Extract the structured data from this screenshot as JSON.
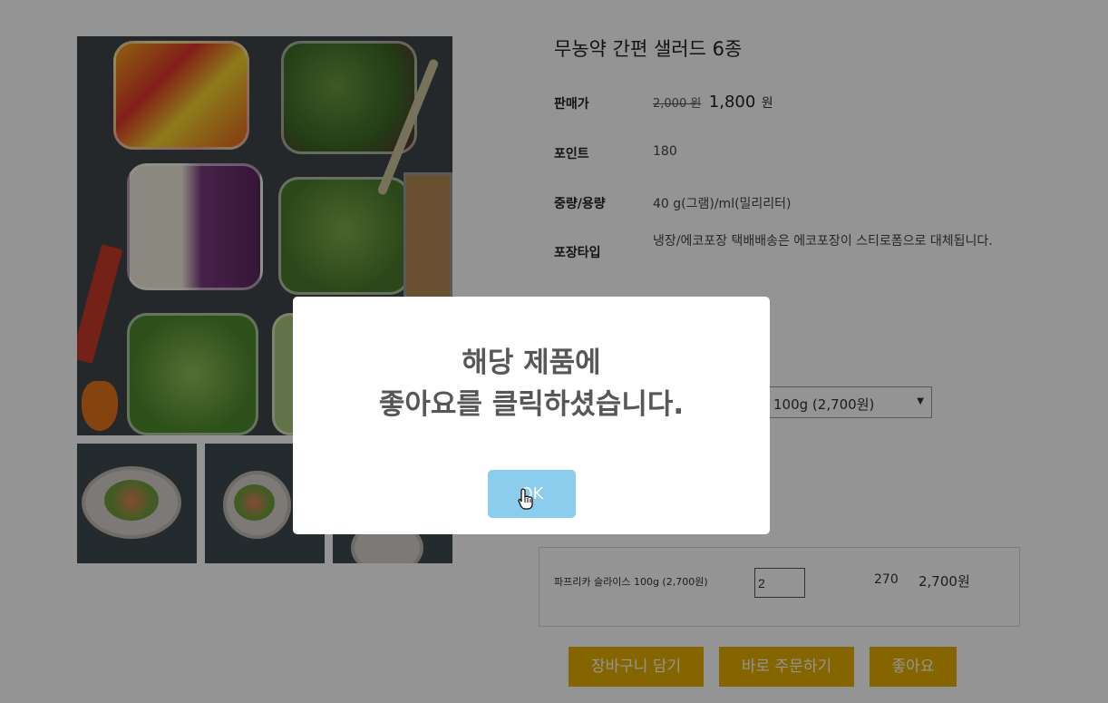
{
  "product": {
    "title": "무농약 간편 샐러드 6종",
    "rows": {
      "price": {
        "label": "판매가",
        "original": "2,000 원",
        "sale": "1,800",
        "sale_unit": "원"
      },
      "points": {
        "label": "포인트",
        "value": "180"
      },
      "weight": {
        "label": "중량/용량",
        "value": "40 g(그램)/ml(밀리리터)"
      },
      "package": {
        "label": "포장타입",
        "value": "냉장/에코포장 택배배송은 에코포장이 스티로폼으로 대체됩니다."
      }
    }
  },
  "option_select": {
    "selected": "100g (2,700원)"
  },
  "selected_option": {
    "name": "파프리카 슬라이스 100g (2,700원)",
    "quantity": "2",
    "points": "270",
    "price": "2,700원"
  },
  "actions": {
    "cart": "장바구니 담기",
    "order": "바로 주문하기",
    "like": "좋아요"
  },
  "modal": {
    "line1": "해당 제품에",
    "line2": "좋아요를 클릭하셨습니다.",
    "ok": "OK"
  }
}
